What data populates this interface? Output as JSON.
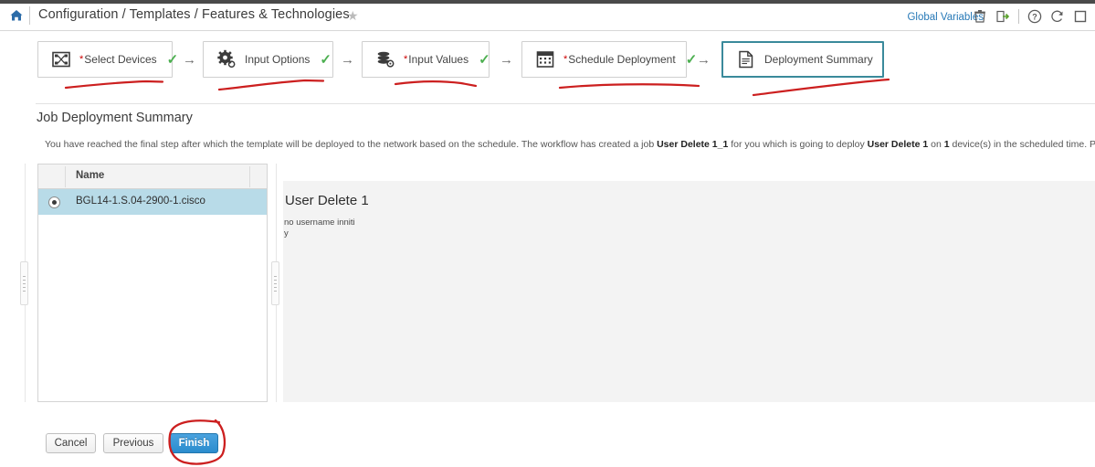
{
  "header": {
    "home_icon": "home-icon",
    "breadcrumb": "Configuration / Templates / Features & Technologies",
    "favorite_icon": "star-icon",
    "global_variables_label": "Global Variables",
    "icons": [
      "trash-icon",
      "export-icon",
      "help-icon",
      "refresh-icon",
      "panel-icon"
    ]
  },
  "wizard": {
    "steps": [
      {
        "label": "Select Devices",
        "required": true,
        "icon": "devices-icon",
        "completed": true,
        "active": false
      },
      {
        "label": "Input Options",
        "required": false,
        "icon": "gear-icon",
        "completed": true,
        "active": false
      },
      {
        "label": "Input Values",
        "required": true,
        "icon": "database-gear-icon",
        "completed": true,
        "active": false
      },
      {
        "label": "Schedule Deployment",
        "required": true,
        "icon": "calendar-icon",
        "completed": true,
        "active": false
      },
      {
        "label": "Deployment Summary",
        "required": false,
        "icon": "document-icon",
        "completed": false,
        "active": true
      }
    ],
    "arrow_glyph": "→",
    "check_glyph": "✓",
    "required_marker": "*"
  },
  "panel": {
    "title": "Job Deployment Summary",
    "description_part1": "You have reached the final step after which the template will be deployed to the network based on the schedule. The workflow has created a job ",
    "description_job": "User Delete 1_1",
    "description_part2": " for you which is going to deploy ",
    "description_template": "User Delete 1",
    "description_part3": " on ",
    "description_count": "1",
    "description_part4": " device(s) in the scheduled time. Please click Finish to initiate the job."
  },
  "device_table": {
    "columns": [
      "",
      "Name"
    ],
    "rows": [
      {
        "selected": true,
        "name": "BGL14-1.S.04-2900-1.cisco"
      }
    ]
  },
  "preview": {
    "title": "User Delete 1",
    "cli": "no username inniti\ny"
  },
  "footer": {
    "cancel_label": "Cancel",
    "previous_label": "Previous",
    "finish_label": "Finish"
  },
  "colors": {
    "accent_blue": "#2b8ccd",
    "link_blue": "#2779b7",
    "active_step_border": "#3a8a9b",
    "row_selected": "#b8dbe8",
    "check_green": "#4caf50",
    "required_red": "#cc0000",
    "annotation_red": "#cc1f1f"
  }
}
